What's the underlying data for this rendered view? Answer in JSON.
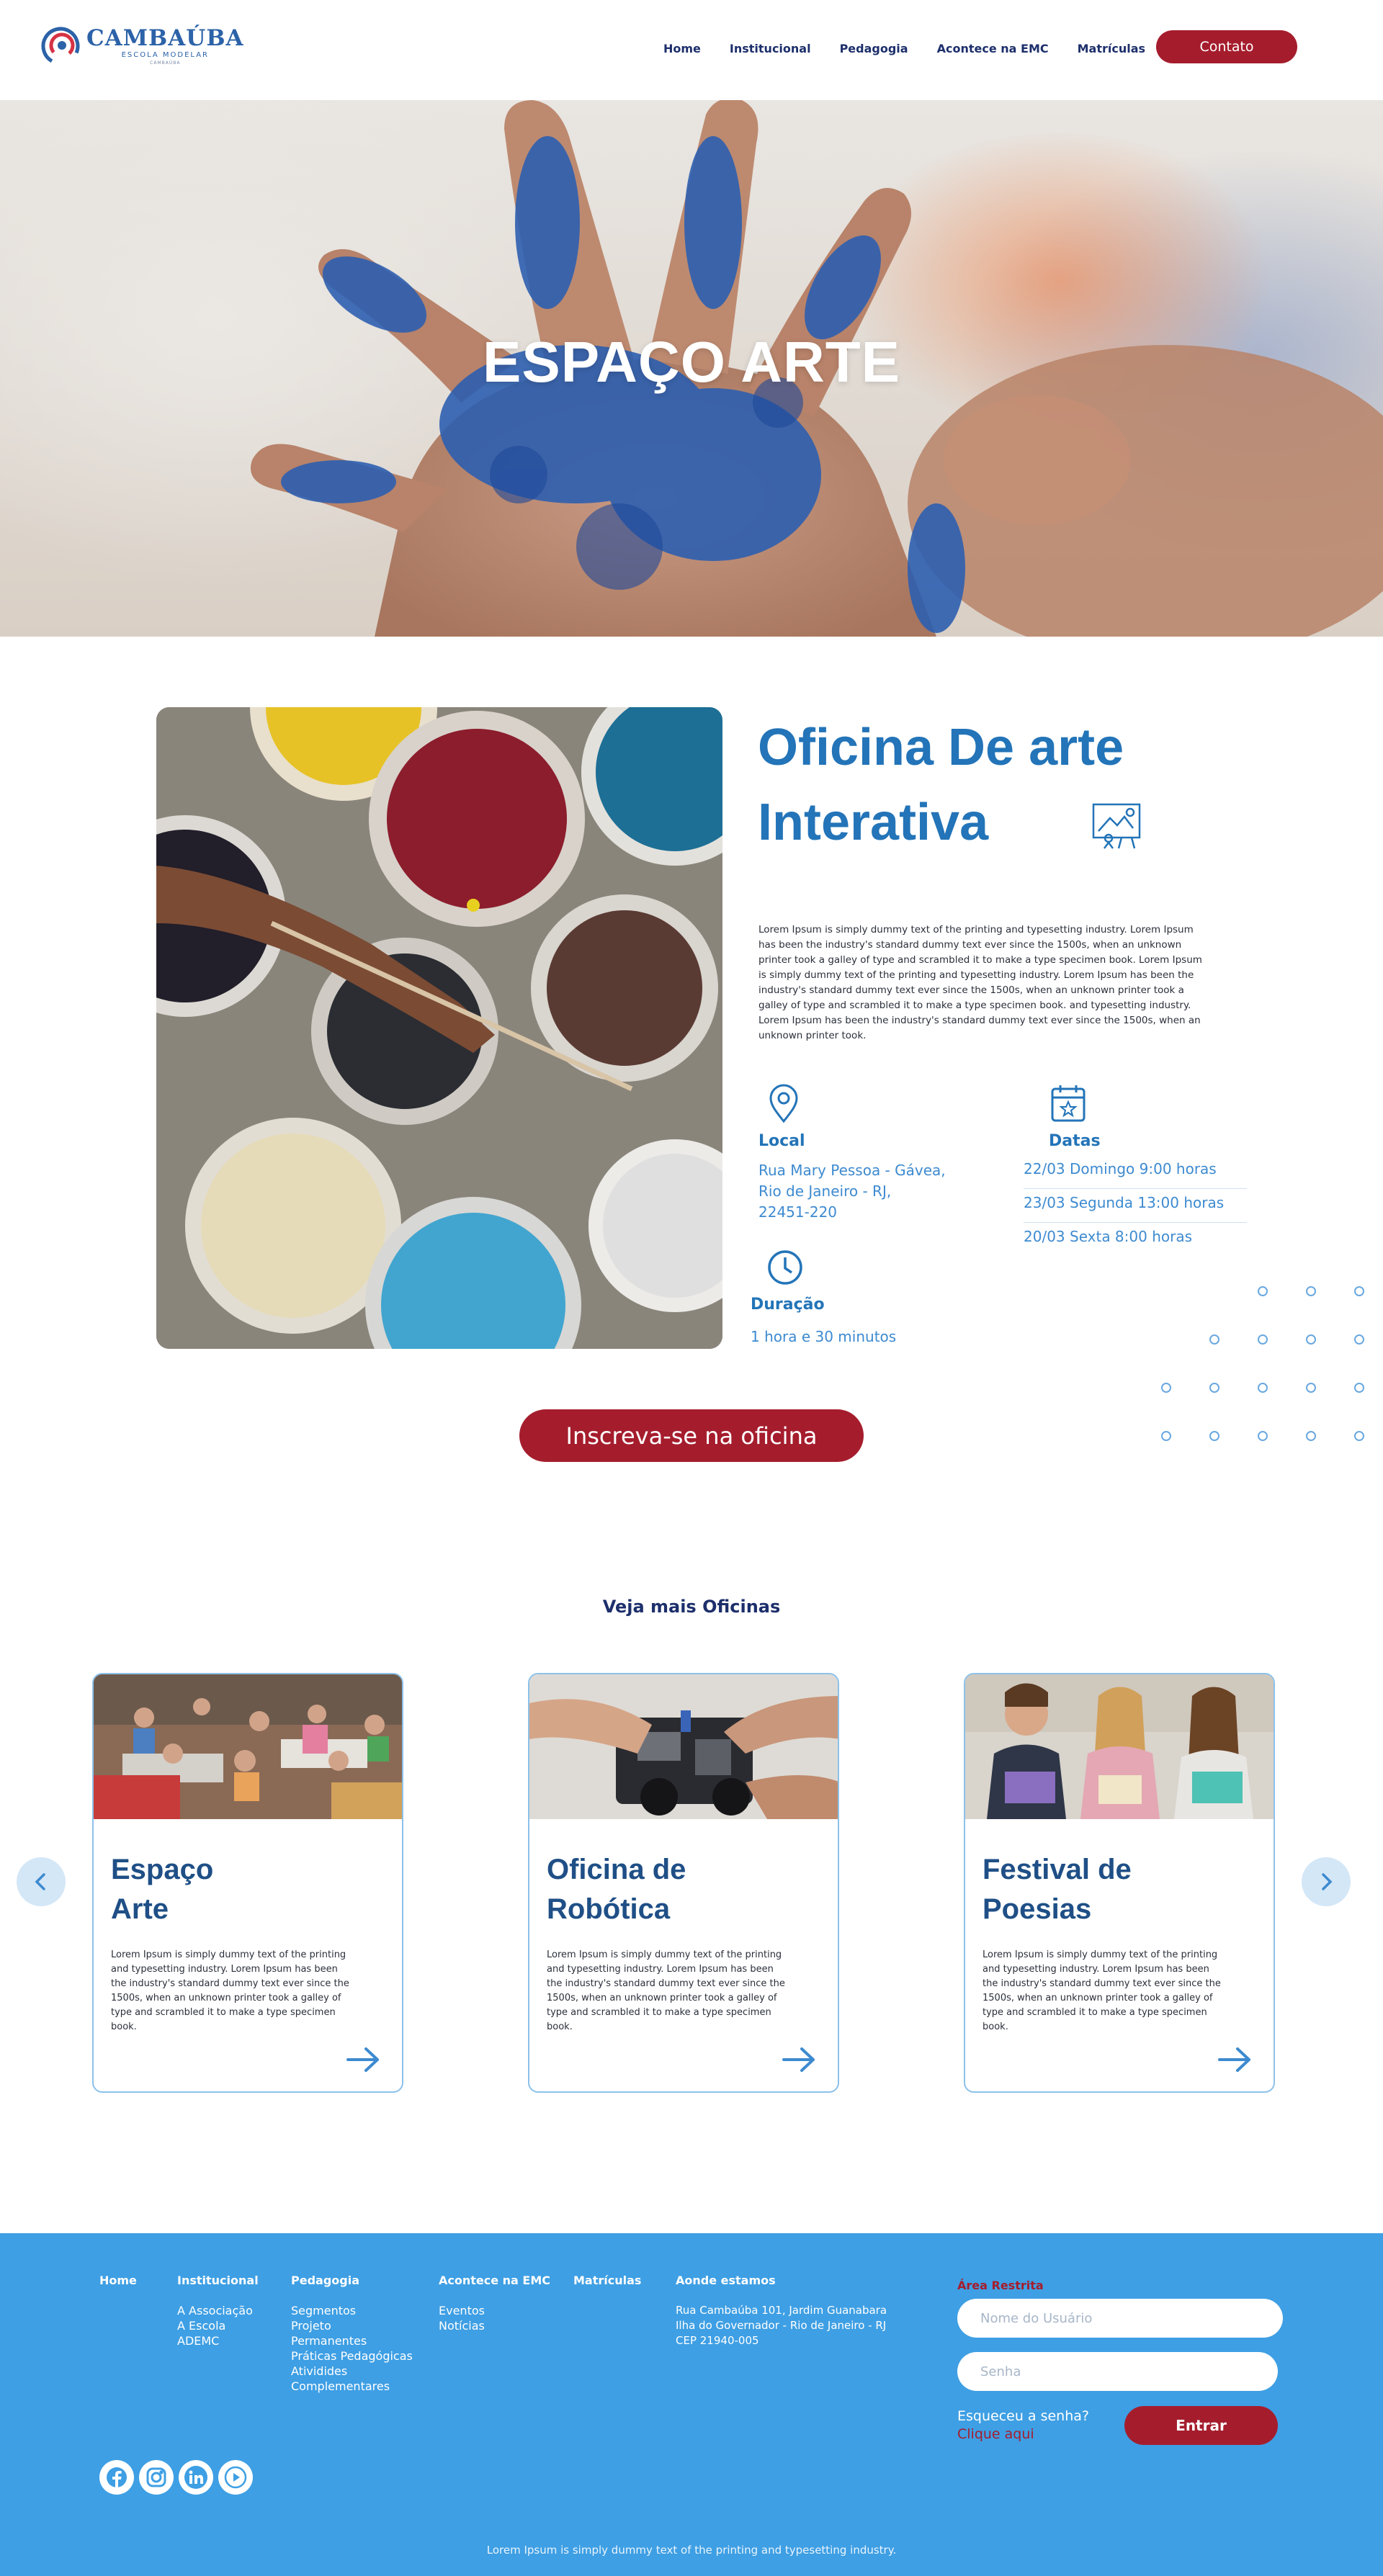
{
  "header": {
    "logo_name": "CAMBAÚBA",
    "logo_sub": "ESCOLA MODELAR",
    "logo_sub2": "CAMBAÚBA",
    "nav": [
      {
        "label": "Home"
      },
      {
        "label": "Institucional"
      },
      {
        "label": "Pedagogia"
      },
      {
        "label": "Acontece na EMC"
      },
      {
        "label": "Matrículas"
      }
    ],
    "contact_label": "Contato"
  },
  "hero": {
    "title": "ESPAÇO ARTE"
  },
  "workshop": {
    "title_line1": "Oficina De arte",
    "title_line2": "Interativa",
    "description": "Lorem Ipsum is simply dummy text of the printing and typesetting industry. Lorem Ipsum has been the industry's standard dummy text ever since the 1500s, when an unknown printer took a galley of type and scrambled it to make a type specimen book. Lorem Ipsum is simply dummy text of the printing and typesetting industry. Lorem Ipsum has been the industry's standard dummy text ever since the 1500s, when an unknown printer took a galley of type and scrambled it to make a type specimen book.  and typesetting industry. Lorem Ipsum has been the industry's standard dummy text ever since the 1500s, when an unknown printer took.",
    "local_label": "Local",
    "local_line1": "Rua Mary Pessoa - Gávea,",
    "local_line2": "Rio de Janeiro - RJ,",
    "local_line3": "22451-220",
    "dates_label": "Datas",
    "dates": [
      "22/03 Domingo  9:00 horas",
      "23/03 Segunda  13:00 horas",
      "20/03 Sexta 8:00 horas"
    ],
    "duration_label": "Duração",
    "duration_value": "1 hora e 30 minutos",
    "cta_label": "Inscreva-se na oficina"
  },
  "more": {
    "title": "Veja mais Oficinas",
    "cards": [
      {
        "title_line1": "Espaço",
        "title_line2": "Arte",
        "text": "Lorem Ipsum is simply dummy text of the printing and typesetting industry. Lorem Ipsum has been the industry's standard dummy text ever since the 1500s, when an unknown printer took a galley of type and scrambled it to make a type specimen book."
      },
      {
        "title_line1": "Oficina de",
        "title_line2": "Robótica",
        "text": "Lorem Ipsum is simply dummy text of the printing and typesetting industry. Lorem Ipsum has been the industry's standard dummy text ever since the 1500s, when an unknown printer took a galley of type and scrambled it to make a type specimen book."
      },
      {
        "title_line1": "Festival de",
        "title_line2": "Poesias",
        "text": "Lorem Ipsum is simply dummy text of the printing and typesetting industry. Lorem Ipsum has been the industry's standard dummy text ever since the 1500s, when an unknown printer took a galley of type and scrambled it to make a type specimen book."
      }
    ]
  },
  "footer": {
    "home": "Home",
    "institucional": {
      "title": "Institucional",
      "links": [
        "A Associação",
        "A Escola",
        "ADEMC"
      ]
    },
    "pedagogia": {
      "title": "Pedagogia",
      "links": [
        "Segmentos",
        "Projeto",
        "Permanentes",
        "Práticas Pedagógicas",
        "Atividides",
        "Complementares"
      ]
    },
    "acontece": {
      "title": "Acontece na EMC",
      "links": [
        "Eventos",
        "Notícias"
      ]
    },
    "matriculas": "Matrículas",
    "onde": {
      "title": "Aonde estamos",
      "lines": [
        "Rua Cambaúba 101, Jardim Guanabara",
        "Ilha do Governador - Rio de Janeiro - RJ",
        "CEP 21940-005"
      ]
    },
    "restricted_title": "Área Restrita",
    "username_placeholder": "Nome do Usuário",
    "password_placeholder": "Senha",
    "forgot_text": "Esqueceu a senha?",
    "forgot_link": "Clique aqui",
    "login_label": "Entrar",
    "copyright": "Lorem Ipsum is simply dummy text of the printing and typesetting industry."
  },
  "colors": {
    "brand_blue": "#2374b8",
    "brand_red": "#a51d2d",
    "footer_blue": "#3e9fe4",
    "nav_navy": "#1d2f6b"
  },
  "icons": [
    "facebook-icon",
    "instagram-icon",
    "linkedin-icon",
    "youtube-icon",
    "map-pin-icon",
    "calendar-icon",
    "clock-icon",
    "art-easel-icon",
    "arrow-right-icon",
    "chevron-left-icon",
    "chevron-right-icon"
  ]
}
